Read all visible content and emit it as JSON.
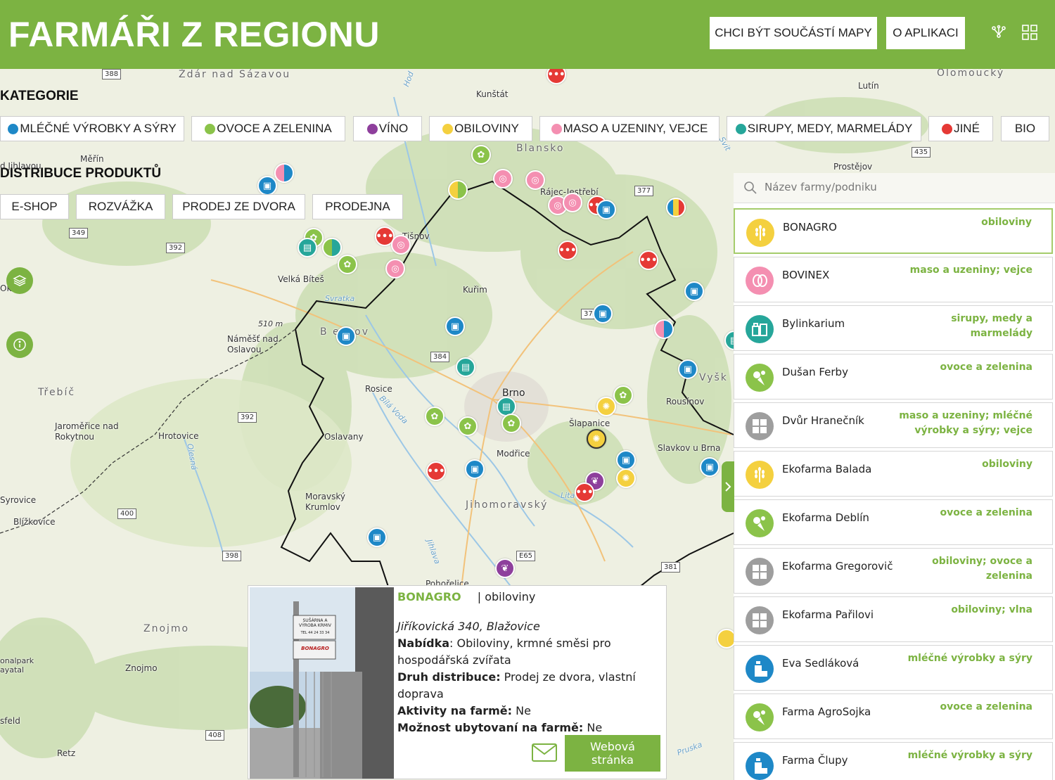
{
  "header": {
    "title": "FARMÁŘI Z REGIONU",
    "join_button": "CHCI BÝT SOUČÁSTÍ MAPY",
    "about_button": "O APLIKACI"
  },
  "categories": {
    "label": "KATEGORIE",
    "items": [
      {
        "label": "MLÉČNÉ VÝROBKY A SÝRY",
        "color": "#1e88c7"
      },
      {
        "label": "OVOCE A ZELENINA",
        "color": "#8bc34a"
      },
      {
        "label": "VÍNO",
        "color": "#8e3f9c"
      },
      {
        "label": "OBILOVINY",
        "color": "#f4d03f"
      },
      {
        "label": "MASO A UZENINY, VEJCE",
        "color": "#f48fb1"
      },
      {
        "label": "SIRUPY, MEDY, MARMELÁDY",
        "color": "#26a69a"
      },
      {
        "label": "JINÉ",
        "color": "#e53935"
      },
      {
        "label": "BIO",
        "color": ""
      }
    ]
  },
  "distribution": {
    "label": "DISTRIBUCE PRODUKTŮ",
    "items": [
      "E-SHOP",
      "ROZVÁŽKA",
      "PRODEJ ZE DVORA",
      "PRODEJNA"
    ]
  },
  "map": {
    "places": {
      "zdar": "Ždár nad Sázavou",
      "olomoucky": "Olomoucký",
      "kunstat": "Kunštát",
      "lutin": "Lutín",
      "blansko": "Blansko",
      "merin": "Měřín",
      "jihlavou": "d Jihlavou",
      "prostejov": "Prostějov",
      "rajec": "Rájec-Jestřebí",
      "tisnov": "Tišnov",
      "velka_bites": "Velká Bíteš",
      "kurim": "Kuřim",
      "okr": "Okr",
      "namest": "Náměšť nad Oslavou",
      "height": "510 m",
      "brnenkov": "B  enkov",
      "vysk": "Vyšk",
      "trebic": "Třebíč",
      "rosice": "Rosice",
      "brno": "Brno",
      "rousinov": "Rousínov",
      "jaromerice": "Jaroměřice nad Rokytnou",
      "hrotovice": "Hrotovice",
      "oslavany": "Oslavany",
      "slapanice": "Šlapanice",
      "slavkov": "Slavkov u Brna",
      "modrice": "Modřice",
      "syrovice": "Syrovice",
      "blizkovice": "Blížkovice",
      "moravsky": "Moravský Krumlov",
      "jihomoravsky": "Jihomoravský",
      "pohorelice": "Pohořelice",
      "znojmo_big": "Znojmo",
      "znojmo": "Znojmo",
      "narodni": "onalpark ayatal",
      "sfeld": "sfeld",
      "retz": "Retz"
    },
    "rivers": {
      "svratka": "Svratka",
      "bila_voda": "Bílá Voda",
      "jihlava": "Jihlava",
      "litava": "Litava",
      "olesna": "Olesná",
      "hodonka": "Hod",
      "svit": "Svit",
      "pruska": "Pruska"
    },
    "roads": [
      "388",
      "435",
      "377",
      "349",
      "392",
      "37",
      "384",
      "392",
      "400",
      "398",
      "E65",
      "381",
      "408"
    ]
  },
  "sidebar": {
    "search_placeholder": "Název farmy/podniku",
    "farms": [
      {
        "name": "BONAGRO",
        "category": "obiloviny",
        "icon": "wheat-icon",
        "color": "#f4d03f"
      },
      {
        "name": "BOVINEX",
        "category": "maso a uzeniny; vejce",
        "icon": "meat-icon",
        "color": "#f48fb1"
      },
      {
        "name": "Bylinkarium",
        "category": "sirupy, medy a marmelády",
        "icon": "jar-icon",
        "color": "#26a69a"
      },
      {
        "name": "Dušan Ferby",
        "category": "ovoce a zelenina",
        "icon": "vegetable-icon",
        "color": "#8bc34a"
      },
      {
        "name": "Dvůr Hranečník",
        "category": "maso a uzeniny; mléčné výrobky a sýry; vejce",
        "icon": "mixed-icon",
        "color": "#9e9e9e"
      },
      {
        "name": "Ekofarma Balada",
        "category": "obiloviny",
        "icon": "wheat-icon",
        "color": "#f4d03f"
      },
      {
        "name": "Ekofarma Deblín",
        "category": "ovoce a zelenina",
        "icon": "vegetable-icon",
        "color": "#8bc34a"
      },
      {
        "name": "Ekofarma Gregorovič",
        "category": "obiloviny; ovoce a zelenina",
        "icon": "mixed-icon",
        "color": "#9e9e9e"
      },
      {
        "name": "Ekofarma Pařilovi",
        "category": "obiloviny; vlna",
        "icon": "mixed-icon",
        "color": "#9e9e9e"
      },
      {
        "name": "Eva Sedláková",
        "category": "mléčné výrobky a sýry",
        "icon": "milk-icon",
        "color": "#1e88c7"
      },
      {
        "name": "Farma AgroSojka",
        "category": "ovoce a zelenina",
        "icon": "vegetable-icon",
        "color": "#8bc34a"
      },
      {
        "name": "Farma Člupy",
        "category": "mléčné výrobky a sýry",
        "icon": "milk-icon",
        "color": "#1e88c7"
      }
    ]
  },
  "popup": {
    "name": "BONAGRO",
    "category": "| obiloviny",
    "address": "Jiříkovická 340, Blažovice",
    "offer_label": "Nabídka",
    "offer_value": ": Obiloviny, krmné směsi pro hospodářská zvířata",
    "distribution_label": "Druh distribuce:",
    "distribution_value": " Prodej ze dvora, vlastní doprava",
    "activities_label": "Aktivity na farmě:",
    "activities_value": " Ne",
    "lodging_label": "Možnost ubytovaní na farmě:",
    "lodging_value": " Ne",
    "web_button": "Webová stránka",
    "photo_sign_1": "SUŠÁRNA A VÝROBA KRMIV",
    "photo_sign_2": "TEL 44 24 33 34",
    "photo_sign_3": "BONAGRO"
  },
  "colors": {
    "brand": "#7cb342",
    "red": "#e53935",
    "pink": "#f48fb1",
    "blue": "#1e88c7",
    "teal": "#26a69a",
    "yellow": "#f4d03f",
    "green": "#8bc34a",
    "purple": "#8e3f9c"
  }
}
